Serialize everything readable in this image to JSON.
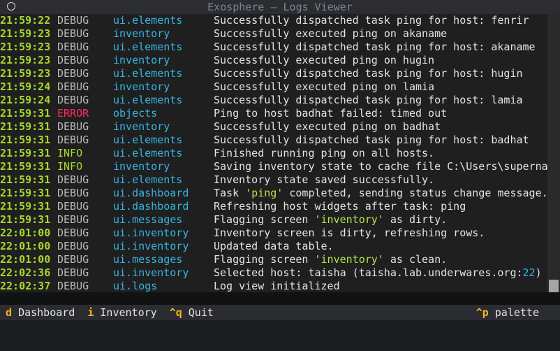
{
  "window": {
    "title": "Exosphere — Logs Viewer"
  },
  "logs": [
    {
      "time": "21:59:22",
      "level": "DEBUG",
      "source": "ui.elements",
      "message": "Successfully dispatched task ping for host: fenrir"
    },
    {
      "time": "21:59:23",
      "level": "DEBUG",
      "source": "inventory",
      "message": "Successfully executed ping on akaname"
    },
    {
      "time": "21:59:23",
      "level": "DEBUG",
      "source": "ui.elements",
      "message": "Successfully dispatched task ping for host: akaname"
    },
    {
      "time": "21:59:23",
      "level": "DEBUG",
      "source": "inventory",
      "message": "Successfully executed ping on hugin"
    },
    {
      "time": "21:59:23",
      "level": "DEBUG",
      "source": "ui.elements",
      "message": "Successfully dispatched task ping for host: hugin"
    },
    {
      "time": "21:59:24",
      "level": "DEBUG",
      "source": "inventory",
      "message": "Successfully executed ping on lamia"
    },
    {
      "time": "21:59:24",
      "level": "DEBUG",
      "source": "ui.elements",
      "message": "Successfully dispatched task ping for host: lamia"
    },
    {
      "time": "21:59:31",
      "level": "ERROR",
      "source": "objects",
      "message": "Ping to host badhat failed: timed out"
    },
    {
      "time": "21:59:31",
      "level": "DEBUG",
      "source": "inventory",
      "message": "Successfully executed ping on badhat"
    },
    {
      "time": "21:59:31",
      "level": "DEBUG",
      "source": "ui.elements",
      "message": "Successfully dispatched task ping for host: badhat"
    },
    {
      "time": "21:59:31",
      "level": "INFO",
      "source": "ui.elements",
      "message": "Finished running ping on all hosts."
    },
    {
      "time": "21:59:31",
      "level": "INFO",
      "source": "inventory",
      "message": "Saving inventory state to cache file C:\\Users\\superna"
    },
    {
      "time": "21:59:31",
      "level": "DEBUG",
      "source": "ui.elements",
      "message": "Inventory state saved successfully."
    },
    {
      "time": "21:59:31",
      "level": "DEBUG",
      "source": "ui.dashboard",
      "message": "Task 'ping' completed, sending status change message."
    },
    {
      "time": "21:59:31",
      "level": "DEBUG",
      "source": "ui.dashboard",
      "message": "Refreshing host widgets after task: ping"
    },
    {
      "time": "21:59:31",
      "level": "DEBUG",
      "source": "ui.messages",
      "message": "Flagging screen 'inventory' as dirty."
    },
    {
      "time": "22:01:00",
      "level": "DEBUG",
      "source": "ui.inventory",
      "message": "Inventory screen is dirty, refreshing rows."
    },
    {
      "time": "22:01:00",
      "level": "DEBUG",
      "source": "ui.inventory",
      "message": "Updated data table."
    },
    {
      "time": "22:01:00",
      "level": "DEBUG",
      "source": "ui.messages",
      "message": "Flagging screen 'inventory' as clean."
    },
    {
      "time": "22:02:36",
      "level": "DEBUG",
      "source": "ui.inventory",
      "message": "Selected host: taisha (taisha.lab.underwares.org:22)"
    },
    {
      "time": "22:02:37",
      "level": "DEBUG",
      "source": "ui.logs",
      "message": "Log view initialized"
    }
  ],
  "footer": {
    "bindings": [
      {
        "key": "d",
        "label": "Dashboard"
      },
      {
        "key": "i",
        "label": "Inventory"
      },
      {
        "key": "^q",
        "label": "Quit"
      }
    ],
    "palette": {
      "key": "^p",
      "label": "palette"
    }
  },
  "colors": {
    "time": "#a4d82b",
    "error": "#ff2d5f",
    "info": "#a4d82b",
    "source": "#35b6e0",
    "key": "#f6b61b"
  }
}
